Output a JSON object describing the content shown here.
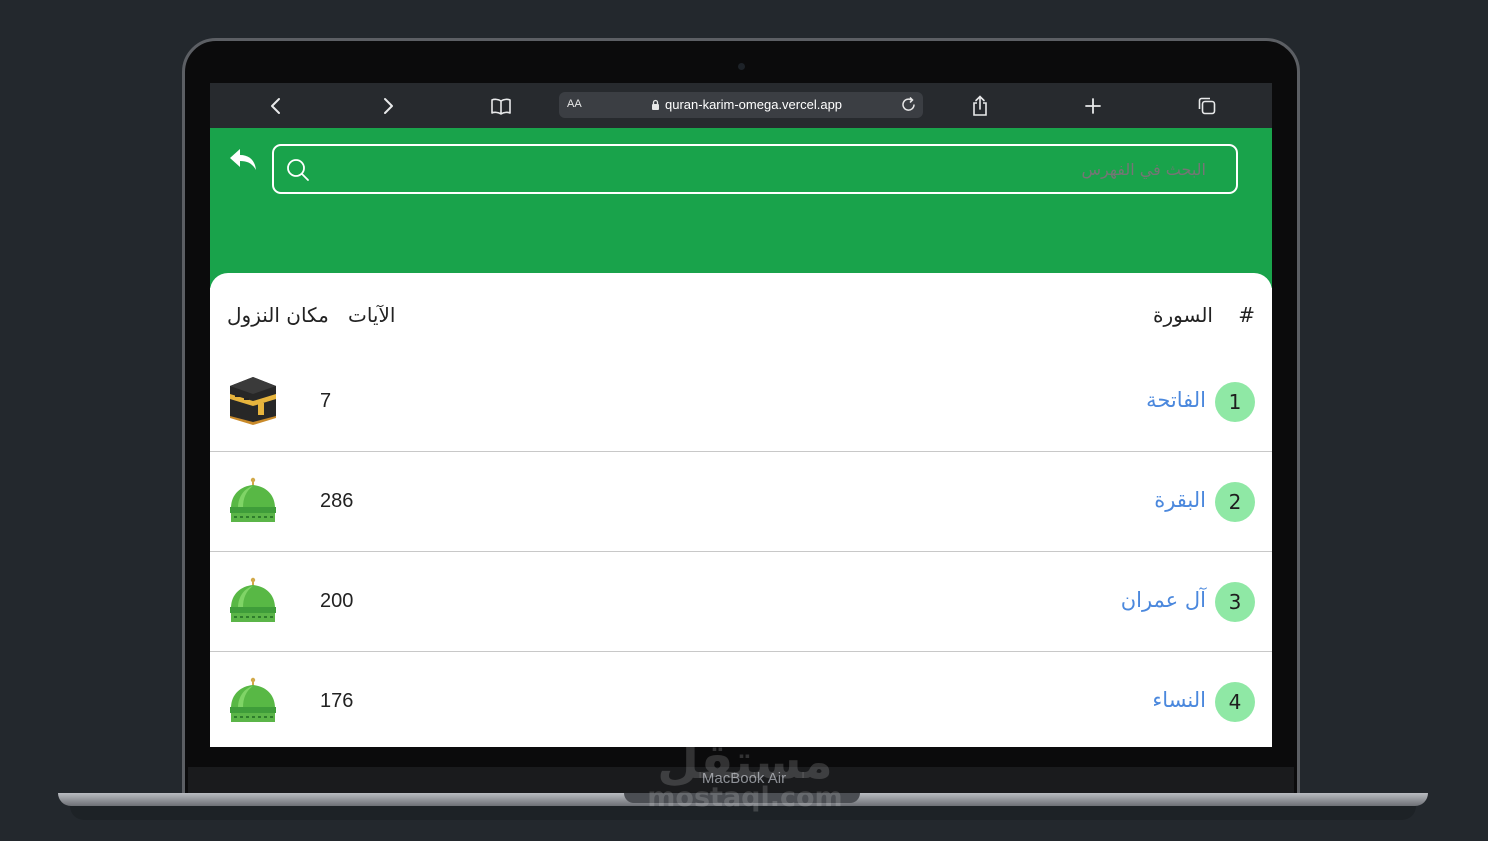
{
  "device": {
    "model_label": "MacBook Air"
  },
  "browser": {
    "aa_label": "AA",
    "url": "quran-karim-omega.vercel.app"
  },
  "search": {
    "placeholder": "البحث في الفهرس",
    "value": ""
  },
  "table": {
    "headers": {
      "number": "#",
      "surah": "السورة",
      "ayat": "الآيات",
      "place": "مكان النزول"
    },
    "rows": [
      {
        "number": "1",
        "name": "الفاتحة",
        "ayat": "7",
        "place_icon": "kaaba-icon"
      },
      {
        "number": "2",
        "name": "البقرة",
        "ayat": "286",
        "place_icon": "green-dome-icon"
      },
      {
        "number": "3",
        "name": "آل عمران",
        "ayat": "200",
        "place_icon": "green-dome-icon"
      },
      {
        "number": "4",
        "name": "النساء",
        "ayat": "176",
        "place_icon": "green-dome-icon"
      }
    ]
  },
  "watermark": {
    "arabic": "مستقل",
    "latin": "mostaql.com"
  },
  "colors": {
    "header_green": "#19a34b",
    "badge_green": "#8fe8a5",
    "link_blue": "#4b88dd"
  }
}
